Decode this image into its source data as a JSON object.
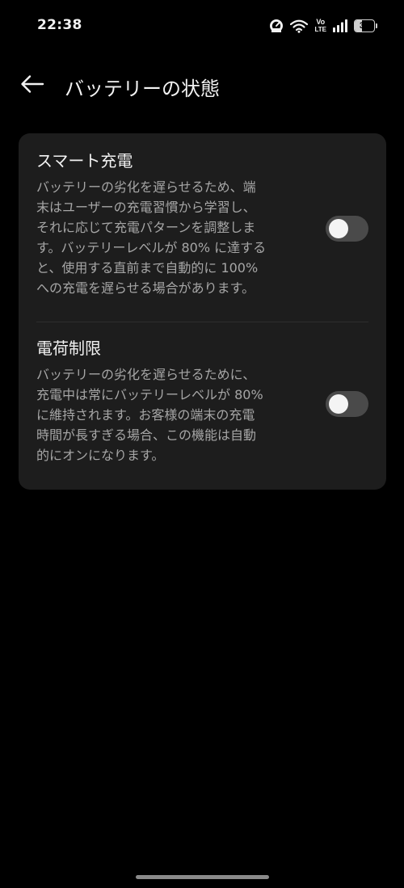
{
  "status_bar": {
    "time": "22:38",
    "network_lte_top": "Vo",
    "network_lte_bottom": "LTE",
    "battery_level": "37",
    "icons": [
      "speed-meter-icon",
      "wifi-icon",
      "volte-icon",
      "signal-icon",
      "battery-icon"
    ]
  },
  "header": {
    "back_icon": "arrow-left-icon",
    "title": "バッテリーの状態"
  },
  "settings": {
    "smart_charging": {
      "title": "スマート充電",
      "description_lines": [
        "バッテリーの劣化を遅らせるため、端",
        "末はユーザーの充電習慣から学習し、",
        "それに応じて充電パターンを調整しま",
        "す。バッテリーレベルが 80% に達する",
        "と、使用する直前まで自動的に 100%",
        "への充電を遅らせる場合があります。"
      ],
      "enabled": false
    },
    "charge_limit": {
      "title": "電荷制限",
      "description_lines": [
        "バッテリーの劣化を遅らせるために、",
        "充電中は常にバッテリーレベルが 80%",
        "に維持されます。お客様の端末の充電",
        "時間が長すぎる場合、この機能は自動",
        "的にオンになります。"
      ],
      "enabled": false
    }
  },
  "colors": {
    "background": "#000000",
    "card": "#1d1d1d",
    "title_text": "#f2f2f2",
    "desc_text": "#a6a6a6",
    "toggle_off_track": "#4a4a4a",
    "toggle_knob": "#f4f4f4"
  }
}
